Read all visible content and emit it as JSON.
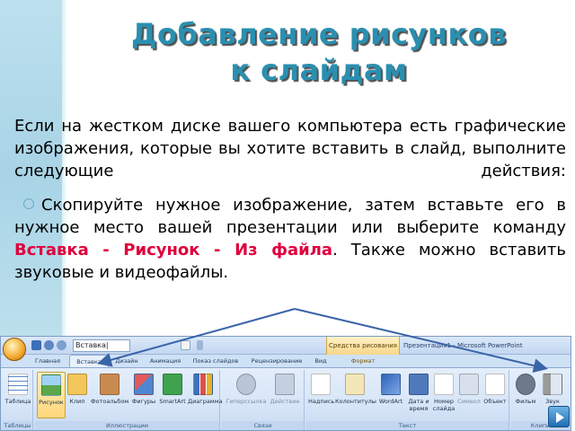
{
  "slide": {
    "title_line1": "Добавление рисунков",
    "title_line2": "к слайдам",
    "paragraph": "Если на жестком диске вашего компьютера есть графические изображения, которые вы хотите вставить в слайд, выполните следующие действия:",
    "bullet": {
      "before": "Скопируйте нужное изображение, затем вставьте его в нужное место вашей презентации или выберите команду ",
      "cmd1": "Вставка",
      "sep1": " - ",
      "cmd2": "Рисунок",
      "sep2": " - ",
      "cmd3": "Из файла",
      "after": ". Также можно вставить звуковые и видеофайлы."
    }
  },
  "ribbon": {
    "qat_text": "Вставка|",
    "context_tab": "Средства рисования",
    "window_title": "Презентация1 - Microsoft PowerPoint",
    "tabs": [
      "Главная",
      "Вставка",
      "Дизайн",
      "Анимация",
      "Показ слайдов",
      "Рецензирование",
      "Вид",
      "Формат"
    ],
    "buttons": [
      "Таблица",
      "Рисунок",
      "Клип",
      "Фотоальбом",
      "Фигуры",
      "SmartArt",
      "Диаграмма",
      "Гиперссылка",
      "Действие",
      "Надпись",
      "Колонтитулы",
      "WordArt",
      "Дата и время",
      "Номер слайда",
      "Символ",
      "Объект",
      "Фильм",
      "Звук"
    ],
    "groups": [
      "Таблицы",
      "Иллюстрации",
      "Связи",
      "Текст",
      "Клипы мультимедиа"
    ]
  },
  "colors": {
    "title": "#2a8fb0",
    "accent_red": "#e0003c",
    "arrow": "#3a64a8"
  }
}
